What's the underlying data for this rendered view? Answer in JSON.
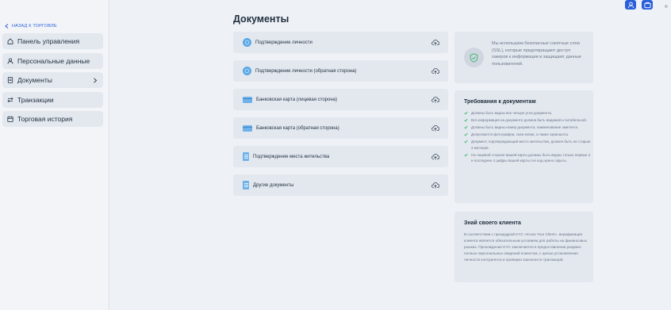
{
  "top_bar": {
    "right_tail": "Ф"
  },
  "sidebar": {
    "back_label": "НАЗАД К ТОРГОВЛЕ",
    "items": [
      {
        "label": "Панель управления",
        "icon": "home-icon"
      },
      {
        "label": "Персональные данные",
        "icon": "user-icon"
      },
      {
        "label": "Документы",
        "icon": "document-icon",
        "has_chevron": true
      },
      {
        "label": "Транзакции",
        "icon": "transfer-icon"
      },
      {
        "label": "Торговая история",
        "icon": "calendar-icon"
      }
    ]
  },
  "main": {
    "title": "Документы",
    "documents": [
      {
        "label": "Подтверждение личности",
        "icon": "identity-badge-icon"
      },
      {
        "label": "Подтверждение личности (обратная сторона)",
        "icon": "identity-badge-icon"
      },
      {
        "label": "Банковская карта (лицевая сторона)",
        "icon": "bank-card-icon"
      },
      {
        "label": "Банковская карта (обратная сторона)",
        "icon": "bank-card-icon"
      },
      {
        "label": "Подтверждение места жительства",
        "icon": "residence-document-icon"
      },
      {
        "label": "Другие документы",
        "icon": "document-icon"
      }
    ]
  },
  "ssl_panel": {
    "text": "Мы используем безопасные сокетные слои (SSL), которые предотвращают доступ хакеров к информации и защищают данные пользователей."
  },
  "requirements_panel": {
    "title": "Требования к документам",
    "items": [
      "Должны быть видны все четыре угла документа.",
      "Вся информация на документе должна быть видимой и читабельной.",
      "Должны быть видны номер документа, наименование эмитента.",
      "Допускаются фотографии, скан-копии, а также скриншоты.",
      "Документ, подтверждающий место жительства, должен быть не старше 3 месяцев.",
      "На лицевой стороне вашей карты должны быть видны только первые 4 и последние 4 цифры вашей карты cvv код нужно скрыть."
    ]
  },
  "kyc_panel": {
    "title": "Знай своего клиента",
    "text": "В соответствии с процедурой KYC «Know Your Client», верификация клиента является обязательным условием для работы на финансовых рынках. Прохождение KYC заключается в предоставлении разумно полных персональных сведений клиентом, с целью установления личности контрагента и проверки законности транзакций."
  },
  "colors": {
    "accent": "#2b5fd9",
    "check": "#35b56a",
    "panel": "#e3e8ef",
    "page": "#eef1f6"
  }
}
